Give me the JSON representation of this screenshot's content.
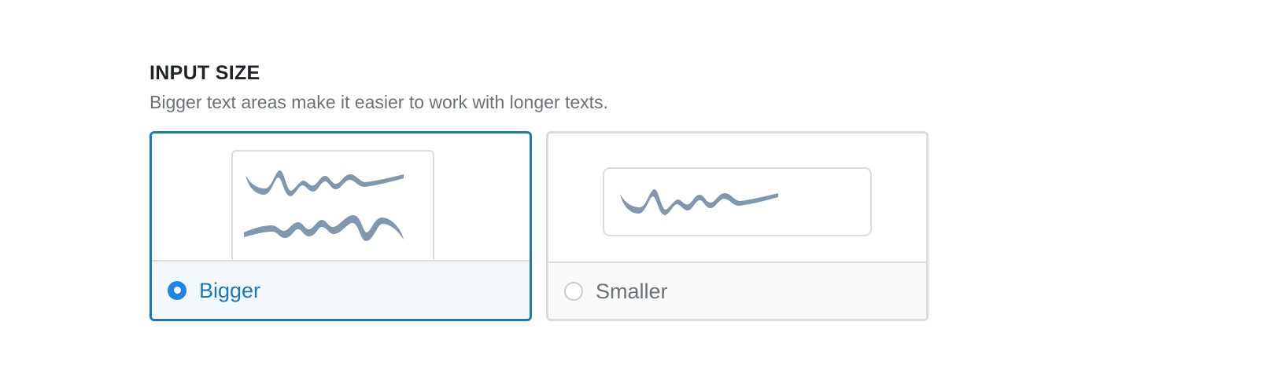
{
  "section": {
    "title": "INPUT SIZE",
    "description": "Bigger text areas make it easier to work with longer texts."
  },
  "options": [
    {
      "label": "Bigger",
      "selected": true,
      "illustration": "two-line-scribble-textarea"
    },
    {
      "label": "Smaller",
      "selected": false,
      "illustration": "one-line-scribble-input"
    }
  ],
  "colors": {
    "accent": "#1b79b8",
    "radio_checked": "#1d86e0",
    "scribble": "#8197ae",
    "border": "#dcdcdc"
  }
}
